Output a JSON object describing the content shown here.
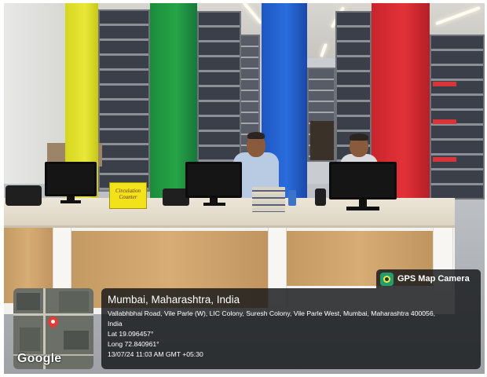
{
  "gps_overlay": {
    "app_name": "GPS Map Camera",
    "location_title": "Mumbai, Maharashtra, India",
    "address_line1": "Vallabhbhai Road, Vile Parle (W), LIC Colony, Suresh Colony, Vile Parle West, Mumbai, Maharashtra 400056,",
    "address_line2": "India",
    "latitude": "Lat 19.096457°",
    "longitude": "Long 72.840961°",
    "timestamp": "13/07/24 11:03 AM GMT +05:30",
    "map_brand": "Google"
  },
  "scene": {
    "counter_sign": "Circulation Counter",
    "pillar_colors": [
      "#e0df30",
      "#22a044",
      "#2565d2",
      "#dc2f36"
    ],
    "counter_color": "#e6dfcf",
    "wood_color": "#cca36b"
  }
}
